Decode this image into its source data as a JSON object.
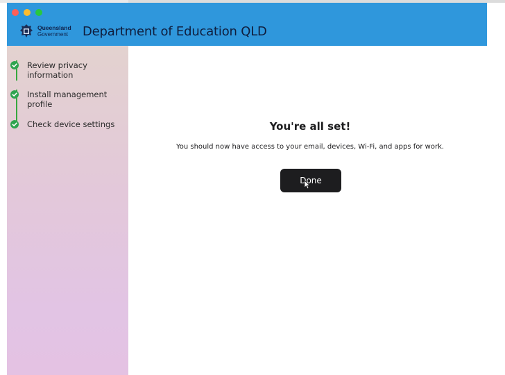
{
  "window": {
    "title": "Department of Education QLD",
    "logo": {
      "line1": "Queensland",
      "line2": "Government"
    },
    "colors": {
      "header": "#2f97dc",
      "check": "#2ea44f",
      "button": "#1d1d1f"
    }
  },
  "sidebar": {
    "steps": [
      {
        "label": "Review privacy information",
        "status": "complete",
        "icon": "check-circle-icon"
      },
      {
        "label": "Install management profile",
        "status": "complete",
        "icon": "check-circle-icon"
      },
      {
        "label": "Check device settings",
        "status": "complete",
        "icon": "check-circle-icon"
      }
    ]
  },
  "main": {
    "heading": "You're all set!",
    "message": "You should now have access to your email, devices, Wi-Fi, and apps for work.",
    "done_label": "Done"
  }
}
